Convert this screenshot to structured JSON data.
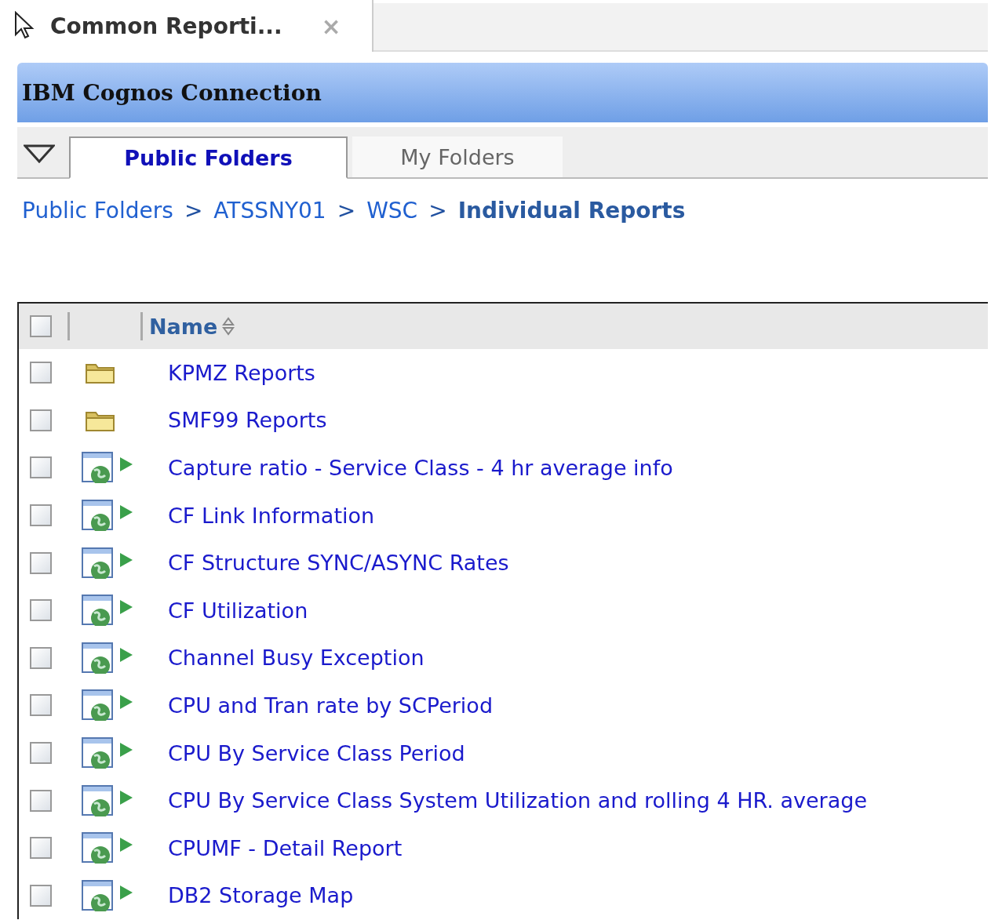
{
  "browser_tab": {
    "title": "Common Reporti...",
    "close": "×"
  },
  "header": {
    "title": "IBM Cognos Connection"
  },
  "tabs": [
    {
      "label": "Public Folders",
      "selected": true
    },
    {
      "label": "My Folders",
      "selected": false
    }
  ],
  "breadcrumb": [
    {
      "label": "Public Folders",
      "current": false
    },
    {
      "label": "ATSSNY01",
      "current": false
    },
    {
      "label": "WSC",
      "current": false
    },
    {
      "label": "Individual Reports",
      "current": true
    }
  ],
  "breadcrumb_separator": ">",
  "table": {
    "select_all_checked": false,
    "name_column": "Name",
    "rows": [
      {
        "kind": "folder",
        "name": "KPMZ Reports",
        "checked": false
      },
      {
        "kind": "folder",
        "name": "SMF99 Reports",
        "checked": false
      },
      {
        "kind": "report",
        "name": "Capture ratio - Service Class - 4 hr average info",
        "checked": false
      },
      {
        "kind": "report",
        "name": "CF Link Information",
        "checked": false
      },
      {
        "kind": "report",
        "name": "CF Structure SYNC/ASYNC Rates",
        "checked": false
      },
      {
        "kind": "report",
        "name": "CF Utilization",
        "checked": false
      },
      {
        "kind": "report",
        "name": "Channel Busy Exception",
        "checked": false
      },
      {
        "kind": "report",
        "name": "CPU and Tran rate by SCPeriod",
        "checked": false
      },
      {
        "kind": "report",
        "name": "CPU By Service Class Period",
        "checked": false
      },
      {
        "kind": "report",
        "name": "CPU By Service Class System Utilization and rolling 4 HR. average",
        "checked": false
      },
      {
        "kind": "report",
        "name": "CPUMF - Detail Report",
        "checked": false
      },
      {
        "kind": "report",
        "name": "DB2 Storage Map",
        "checked": false
      }
    ]
  }
}
